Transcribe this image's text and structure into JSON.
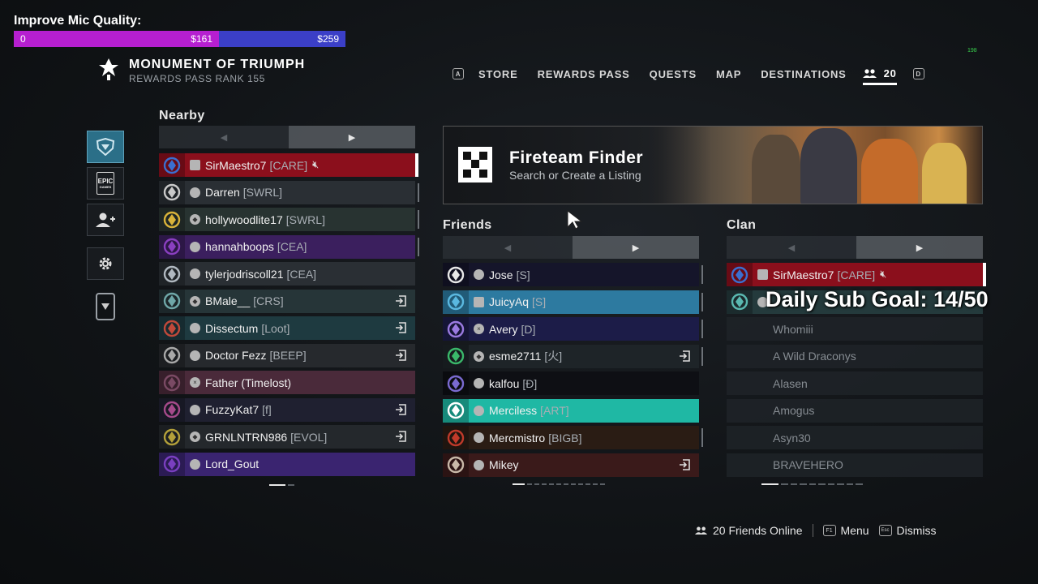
{
  "goal": {
    "label": "Improve Mic Quality:",
    "start": "0",
    "mid": "$161",
    "end": "$259",
    "fill_fraction": 0.62
  },
  "corner_counter": "198",
  "header": {
    "title": "MONUMENT OF TRIUMPH",
    "subtitle": "REWARDS PASS RANK  155"
  },
  "nav": {
    "left_key": "A",
    "items": [
      "STORE",
      "REWARDS PASS",
      "QUESTS",
      "MAP",
      "DESTINATIONS"
    ],
    "friends_count": "20",
    "right_key": "D"
  },
  "rail": {
    "items": [
      "fireteam-icon",
      "epic-games-icon",
      "add-friend-icon",
      "settings-icon"
    ],
    "epic_line1": "EPIC",
    "epic_line2": "GAMES"
  },
  "nearby": {
    "title": "Nearby",
    "rows": [
      {
        "name": "SirMaestro7",
        "tag": "[CARE]",
        "platform": "pc",
        "emblem": "#3b6fd0",
        "bg": "#8b0f1c",
        "muted": true,
        "selected": true,
        "join": false,
        "side": false
      },
      {
        "name": "Darren",
        "tag": "[SWRL]",
        "platform": "steam",
        "emblem": "#c9c9c9",
        "bg": "#2a2f34",
        "join": false,
        "side": true
      },
      {
        "name": "hollywoodlite17",
        "tag": "[SWRL]",
        "platform": "ps",
        "emblem": "#d9b33a",
        "bg": "#283331",
        "join": false,
        "side": true
      },
      {
        "name": "hannahboops",
        "tag": "[CEA]",
        "platform": "steam",
        "emblem": "#8a3fc0",
        "bg": "#3b1f5e",
        "join": false,
        "side": true
      },
      {
        "name": "tylerjodriscoll21",
        "tag": "[CEA]",
        "platform": "steam",
        "emblem": "#b0b8c0",
        "bg": "#2a2f34",
        "join": false,
        "side": false
      },
      {
        "name": "BMale__",
        "tag": "[CRS]",
        "platform": "ps",
        "emblem": "#6fa7a8",
        "bg": "#263538",
        "join": true,
        "side": false
      },
      {
        "name": "Dissectum",
        "tag": "[Loot]",
        "platform": "steam",
        "emblem": "#c0493a",
        "bg": "#1e3a40",
        "join": true,
        "side": false
      },
      {
        "name": "Doctor Fezz",
        "tag": "[BEEP]",
        "platform": "steam",
        "emblem": "#a8a8a8",
        "bg": "#26292d",
        "join": true,
        "side": false
      },
      {
        "name": "Father (Timelost)",
        "tag": "",
        "platform": "xbox",
        "emblem": "#7a4a64",
        "bg": "#4a2a3a",
        "join": false,
        "side": false
      },
      {
        "name": "FuzzyKat7",
        "tag": "[f]",
        "platform": "steam",
        "emblem": "#a54a8a",
        "bg": "#1f2030",
        "join": true,
        "side": false
      },
      {
        "name": "GRNLNTRN986",
        "tag": "[EVOL]",
        "platform": "ps",
        "emblem": "#b3a03a",
        "bg": "#24282c",
        "join": true,
        "side": false
      },
      {
        "name": "Lord_Gout",
        "tag": "",
        "platform": "steam",
        "emblem": "#7a3fc0",
        "bg": "#3a2470",
        "join": false,
        "side": false
      }
    ]
  },
  "finder": {
    "title": "Fireteam Finder",
    "subtitle": "Search or Create a Listing"
  },
  "friends": {
    "title": "Friends",
    "rows": [
      {
        "name": "Jose",
        "tag": "[S]",
        "platform": "steam",
        "emblem": "#e8e8e8",
        "bg": "#15152a",
        "join": false,
        "side": true
      },
      {
        "name": "JuicyAq",
        "tag": "[S]",
        "platform": "pc",
        "emblem": "#5ab8e0",
        "bg": "#2d7aa0",
        "join": false,
        "side": true
      },
      {
        "name": "Avery",
        "tag": "[D]",
        "platform": "xbox",
        "emblem": "#9a7ae0",
        "bg": "#1c1c48",
        "join": false,
        "side": true
      },
      {
        "name": "esme2711",
        "tag": "[火]",
        "platform": "ps",
        "emblem": "#3ab86a",
        "bg": "#1e2428",
        "join": true,
        "side": true
      },
      {
        "name": "kalfou",
        "tag": "[Ð]",
        "platform": "steam",
        "emblem": "#7a6ad0",
        "bg": "#0e0f14",
        "join": false,
        "side": false
      },
      {
        "name": "Merciless",
        "tag": "[ART]",
        "platform": "steam",
        "emblem": "#ffffff",
        "bg": "#1fb8a4",
        "join": false,
        "side": false
      },
      {
        "name": "Mercmistro",
        "tag": "[BIGB]",
        "platform": "steam",
        "emblem": "#c03a2a",
        "bg": "#2a1c14",
        "join": false,
        "side": true
      },
      {
        "name": "Mikey",
        "tag": "",
        "platform": "steam",
        "emblem": "#c8b8a8",
        "bg": "#3a1a1a",
        "join": true,
        "side": false
      }
    ]
  },
  "clan": {
    "title": "Clan",
    "rows": [
      {
        "name": "SirMaestro7",
        "tag": "[CARE]",
        "platform": "pc",
        "emblem": "#3b6fd0",
        "bg": "#8b0f1c",
        "muted": true,
        "selected": true
      },
      {
        "name": "",
        "tag": "",
        "platform": "steam",
        "emblem": "#5ab8b0",
        "bg": "#243a3c",
        "partial": true
      },
      {
        "name": "Whomiii",
        "tag": "",
        "dim": true
      },
      {
        "name": "A Wild Draconys",
        "tag": "",
        "dim": true
      },
      {
        "name": "Alasen",
        "tag": "",
        "dim": true
      },
      {
        "name": "Amogus",
        "tag": "",
        "dim": true
      },
      {
        "name": "Asyn30",
        "tag": "",
        "dim": true
      },
      {
        "name": "BRAVEHERO",
        "tag": "",
        "dim": true
      }
    ]
  },
  "overlay": {
    "daily_goal": "Daily Sub Goal: 14/50"
  },
  "footer": {
    "friends_online": "20 Friends Online",
    "menu_key": "F1",
    "menu_label": "Menu",
    "dismiss_key": "Esc",
    "dismiss_label": "Dismiss"
  },
  "pagination": {
    "nearby_pages": 2,
    "friends_pages": 12,
    "clan_pages": 10,
    "current": 0
  }
}
